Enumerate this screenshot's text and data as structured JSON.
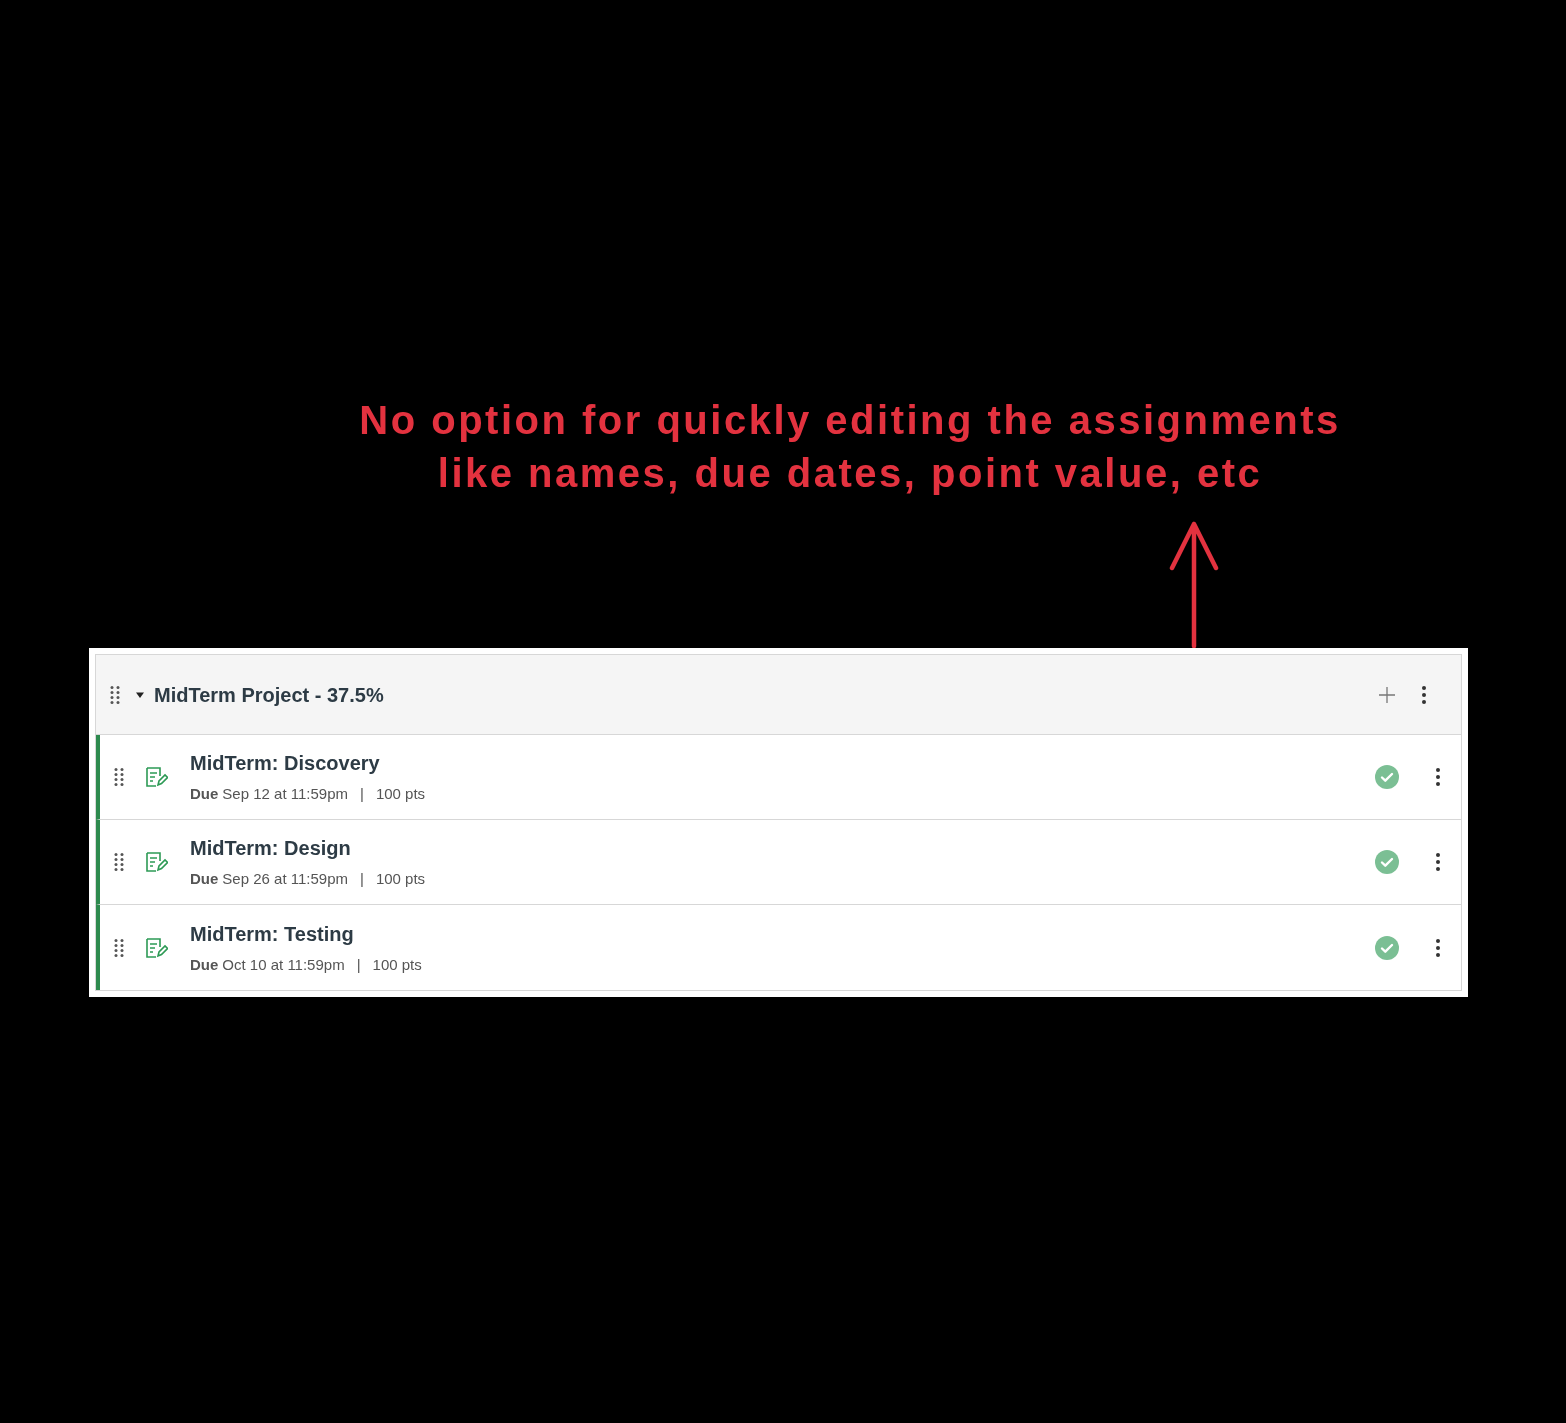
{
  "annotation": {
    "lines": [
      "No option for quickly editing the assignments",
      "like names, due dates, point value, etc"
    ]
  },
  "assignment_group": {
    "title": "MidTerm Project - 37.5%",
    "expanded": true,
    "assignments": [
      {
        "title": "MidTerm: Discovery",
        "due_label": "Due",
        "due": "Sep 12 at 11:59pm",
        "separator": "|",
        "points": "100 pts",
        "published": true
      },
      {
        "title": "MidTerm: Design",
        "due_label": "Due",
        "due": "Sep 26 at 11:59pm",
        "separator": "|",
        "points": "100 pts",
        "published": true
      },
      {
        "title": "MidTerm: Testing",
        "due_label": "Due",
        "due": "Oct 10 at 11:59pm",
        "separator": "|",
        "points": "100 pts",
        "published": true
      }
    ]
  }
}
